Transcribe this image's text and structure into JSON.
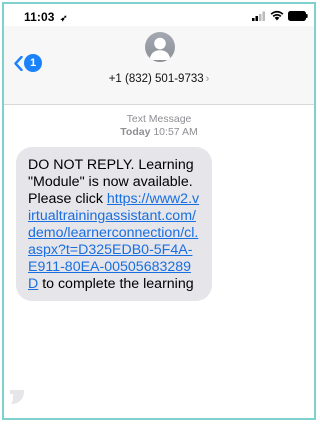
{
  "status_bar": {
    "time": "11:03",
    "location_icon": "location-arrow-icon",
    "signal_icon": "cellular-signal-icon",
    "wifi_icon": "wifi-icon",
    "battery_icon": "battery-icon"
  },
  "header": {
    "back_badge": "1",
    "contact": "+1 (832) 501-9733",
    "chevron": "›",
    "avatar_icon": "person-silhouette-icon"
  },
  "meta": {
    "label": "Text Message",
    "day": "Today",
    "time": "10:57 AM"
  },
  "message": {
    "line1": "DO NOT REPLY.  Learning \"Module\" is now available. Please click ",
    "link": "https://www2.virtualtrainingassistant.com/demo/learnerconnection/cl.aspx?t=D325EDB0-5F4A-E911-80EA-00505683289D",
    "line2": " to complete the learning"
  },
  "colors": {
    "accent": "#1a82fb",
    "bubble": "#e5e5ea",
    "link": "#1a6fe0",
    "frame_border": "#7fd1cf"
  }
}
